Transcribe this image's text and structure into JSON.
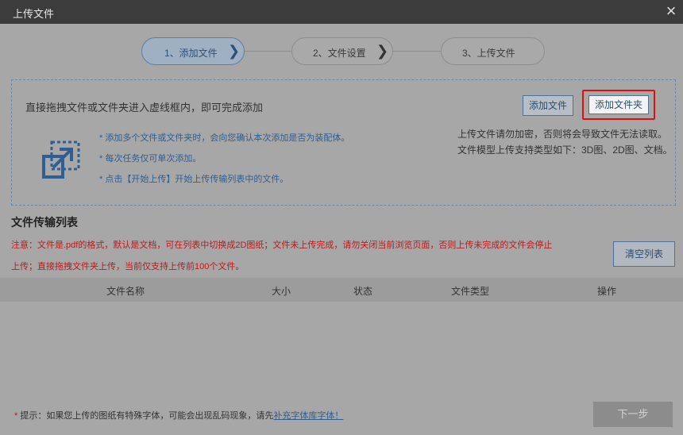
{
  "window": {
    "title": "上传文件",
    "close_glyph": "×"
  },
  "steps": [
    {
      "label": "1、添加文件",
      "active": true
    },
    {
      "label": "2、文件设置",
      "active": false
    },
    {
      "label": "3、上传文件",
      "active": false
    }
  ],
  "step_chevron": "❯",
  "dropzone": {
    "instruction": "直接拖拽文件或文件夹进入虚线框内，即可完成添加",
    "add_file_label": "添加文件",
    "add_folder_label": "添加文件夹",
    "icon": "upload-icon",
    "tips": [
      "* 添加多个文件或文件夹时，会向您确认本次添加是否为装配体。",
      "* 每次任务仅可单次添加。",
      "* 点击【开始上传】开始上传传输列表中的文件。"
    ],
    "note_line1": "上传文件请勿加密，否则将会导致文件无法读取。",
    "note_line2": "文件模型上传支持类型如下：3D图、2D图、文档。"
  },
  "transfer_list": {
    "title": "文件传输列表",
    "notice_line1": "注意：文件是.pdf的格式，默认是文档，可在列表中切换成2D图纸；文件未上传完成，请勿关闭当前浏览页面，否则上传未完成的文件会停止",
    "notice_line2": "上传；直接拖拽文件夹上传，当前仅支持上传前100个文件。",
    "clear_label": "清空列表",
    "columns": [
      "文件名称",
      "大小",
      "状态",
      "文件类型",
      "操作"
    ]
  },
  "footer": {
    "hint_star": "*",
    "hint_text": " 提示：如果您上传的图纸有特殊字体，可能会出现乱码现象，请先",
    "hint_link": "补充字体库字体！",
    "next_label": "下一步"
  },
  "colors": {
    "accent": "#2f5e93",
    "highlight": "#e01010",
    "warning": "#c01818"
  }
}
